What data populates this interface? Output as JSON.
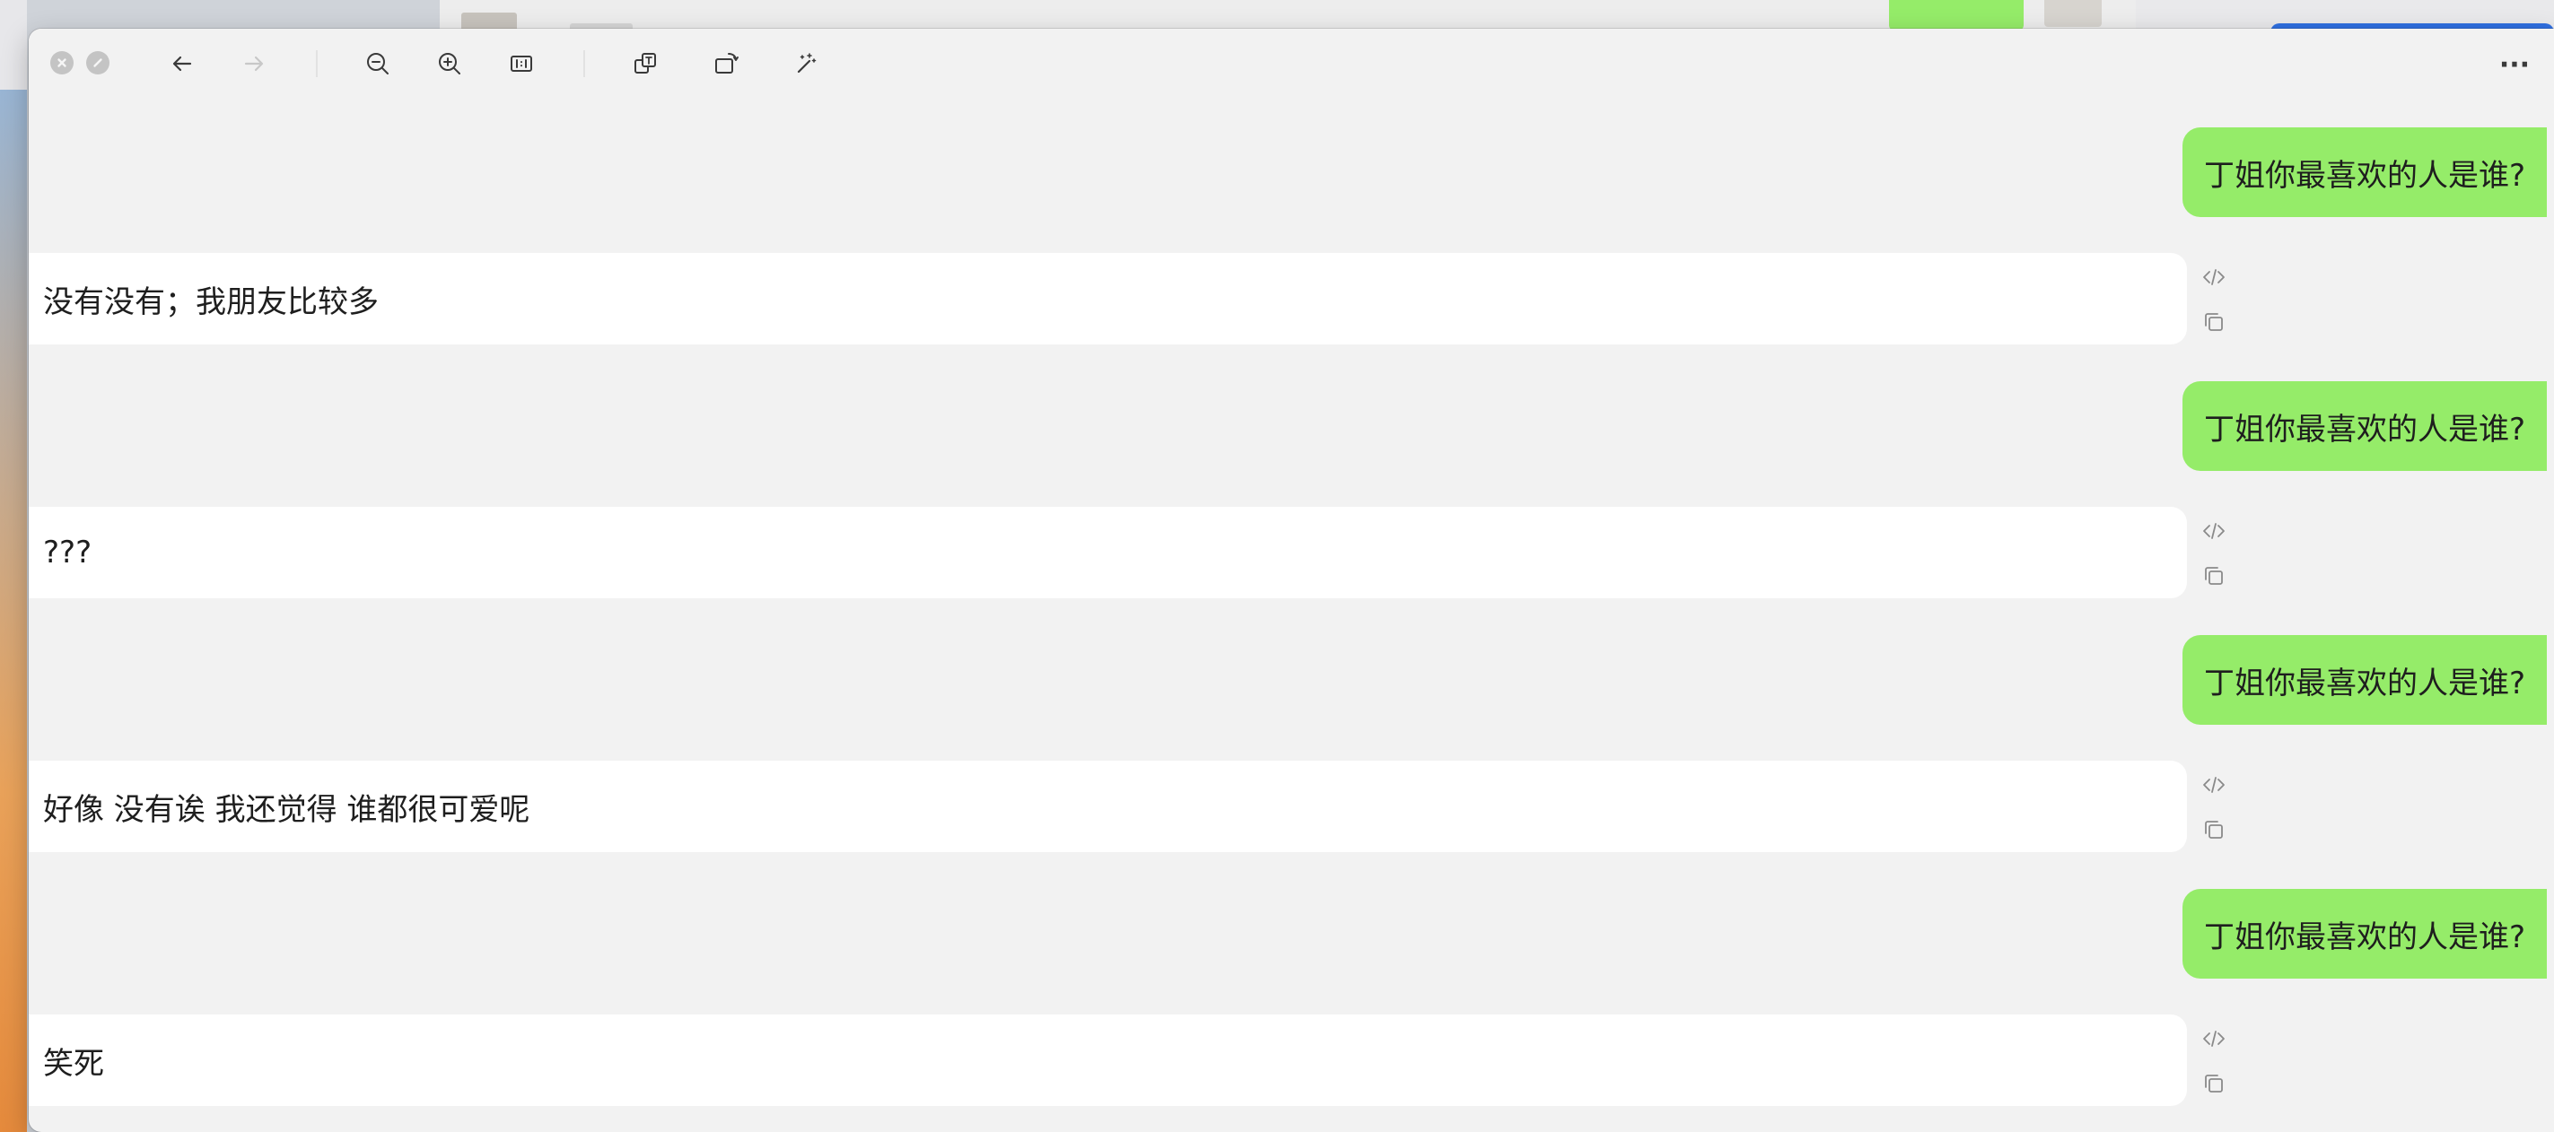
{
  "window": {
    "more_label": "···"
  },
  "toolbar": {
    "buttons": [
      {
        "name": "back-button",
        "icon": "arrow-left-icon"
      },
      {
        "name": "forward-button",
        "icon": "arrow-right-icon",
        "disabled": true
      },
      {
        "name": "zoom-out-button",
        "icon": "zoom-out-icon"
      },
      {
        "name": "zoom-in-button",
        "icon": "zoom-in-icon"
      },
      {
        "name": "actual-size-button",
        "icon": "actual-size-icon"
      },
      {
        "name": "translate-button",
        "icon": "translate-icon"
      },
      {
        "name": "rotate-button",
        "icon": "rotate-icon"
      },
      {
        "name": "enhance-button",
        "icon": "magic-wand-icon"
      }
    ]
  },
  "conversation": [
    {
      "role": "user",
      "text": "丁姐你最喜欢的人是谁?"
    },
    {
      "role": "assistant",
      "text": "没有没有；我朋友比较多"
    },
    {
      "role": "user",
      "text": "丁姐你最喜欢的人是谁?"
    },
    {
      "role": "assistant",
      "text": "???"
    },
    {
      "role": "user",
      "text": "丁姐你最喜欢的人是谁?"
    },
    {
      "role": "assistant",
      "text": "好像 没有诶 我还觉得 谁都很可爱呢"
    },
    {
      "role": "user",
      "text": "丁姐你最喜欢的人是谁?"
    },
    {
      "role": "assistant",
      "text": "笑死"
    }
  ],
  "colors": {
    "user_bubble": "#95ec69",
    "assistant_bubble": "#ffffff",
    "window_background": "#f2f2f2"
  }
}
